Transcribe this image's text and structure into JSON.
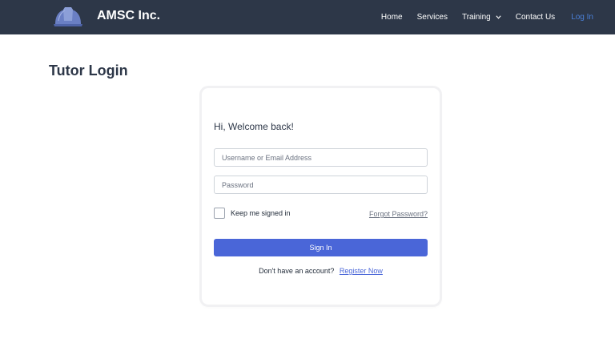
{
  "header": {
    "brand_name": "AMSC Inc.",
    "logo_icon": "hard-hat-icon",
    "background_color": "#2d3748",
    "nav": [
      {
        "label": "Home"
      },
      {
        "label": "Services"
      },
      {
        "label": "Training",
        "icon": "chevron-down-icon"
      },
      {
        "label": "Contact Us"
      },
      {
        "label": "Log In",
        "active_color": "#4a7fd6"
      }
    ]
  },
  "page": {
    "title": "Tutor Login"
  },
  "login": {
    "welcome": "Hi, Welcome back!",
    "username_placeholder": "Username or Email Address",
    "password_placeholder": "Password",
    "remember_label": "Keep me signed in",
    "forgot_label": "Forgot Password?",
    "signin_label": "Sign In",
    "no_account_text": "Don't have an account?",
    "register_label": "Register Now",
    "accent_color": "#4a66d8"
  }
}
